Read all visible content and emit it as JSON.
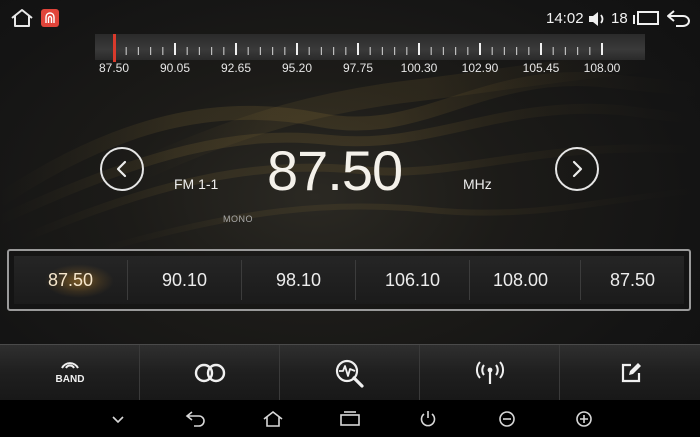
{
  "status_bar": {
    "time": "14:02",
    "volume": "18",
    "icons": [
      "home-outline-icon",
      "red-app-icon",
      "volume-icon",
      "recent-apps-icon",
      "back-arrow-icon"
    ]
  },
  "dial": {
    "labels": [
      "87.50",
      "90.05",
      "92.65",
      "95.20",
      "97.75",
      "100.30",
      "102.90",
      "105.45",
      "108.00"
    ],
    "min": 87.5,
    "max": 108.0,
    "needle_frequency": 87.5,
    "needle_color": "#d93a2c"
  },
  "tuner": {
    "band": "FM 1-1",
    "frequency": "87.50",
    "unit": "MHz",
    "mode": "MONO",
    "prev_icon": "chevron-left-icon",
    "next_icon": "chevron-right-icon"
  },
  "presets": {
    "items": [
      "87.50",
      "90.10",
      "98.10",
      "106.10",
      "108.00",
      "87.50"
    ],
    "active_index": 0,
    "active_glow_color": "#dc9628"
  },
  "toolbar": {
    "band_label": "BAND",
    "buttons": [
      "band-icon",
      "stereo-icon",
      "search-scan-icon",
      "antenna-signal-icon",
      "edit-icon"
    ]
  },
  "navbar": {
    "buttons": [
      "chevron-down-icon",
      "back-icon",
      "home-icon",
      "recents-icon",
      "power-icon",
      "volume-down-icon",
      "volume-up-icon"
    ]
  },
  "colors": {
    "accent": "#dc9628",
    "needle": "#d93a2c",
    "app_icon": "#e0443a"
  }
}
